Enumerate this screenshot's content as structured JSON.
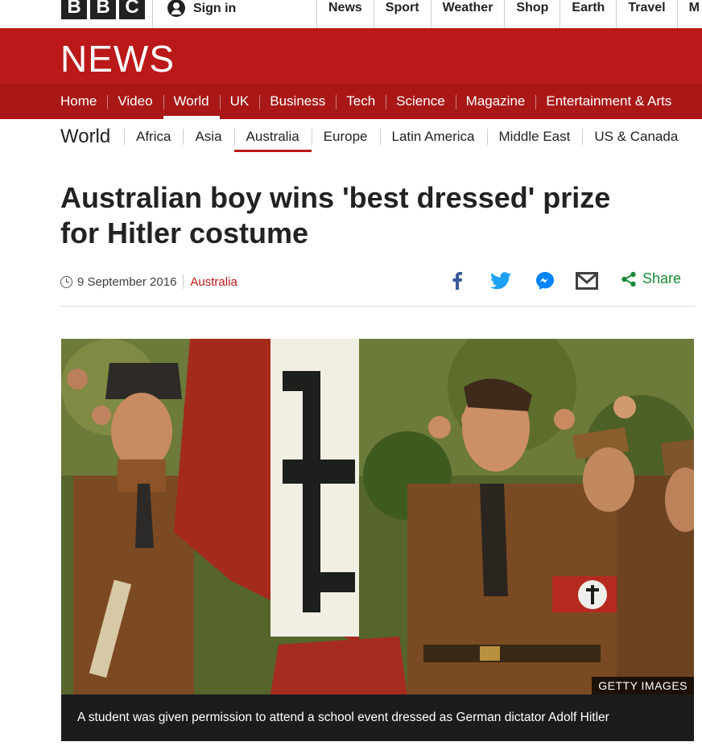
{
  "global_header": {
    "logo_letters": [
      "B",
      "B",
      "C"
    ],
    "sign_in_label": "Sign in",
    "nav": [
      "News",
      "Sport",
      "Weather",
      "Shop",
      "Earth",
      "Travel",
      "M"
    ]
  },
  "banner": {
    "title": "NEWS"
  },
  "news_nav": {
    "items": [
      "Home",
      "Video",
      "World",
      "UK",
      "Business",
      "Tech",
      "Science",
      "Magazine",
      "Entertainment & Arts"
    ],
    "active": "World"
  },
  "section_nav": {
    "title": "World",
    "items": [
      "Africa",
      "Asia",
      "Australia",
      "Europe",
      "Latin America",
      "Middle East",
      "US & Canada"
    ],
    "active": "Australia"
  },
  "article": {
    "headline_line1": "Australian boy wins 'best dressed' prize",
    "headline_line2": "for Hitler costume",
    "date": "9 September 2016",
    "section_link": "Australia",
    "share_label": "Share",
    "image_credit": "GETTY IMAGES",
    "caption": "A student was given permission to attend a school event dressed as German dictator Adolf Hitler"
  },
  "colors": {
    "brand_red": "#bb1919",
    "nav_red": "#a91717",
    "share_green": "#178a34",
    "facebook_blue": "#3b5998",
    "twitter_blue": "#1da1f2"
  },
  "icons": [
    "user-icon",
    "clock-icon",
    "facebook-icon",
    "twitter-icon",
    "messenger-icon",
    "email-icon",
    "share-icon"
  ]
}
